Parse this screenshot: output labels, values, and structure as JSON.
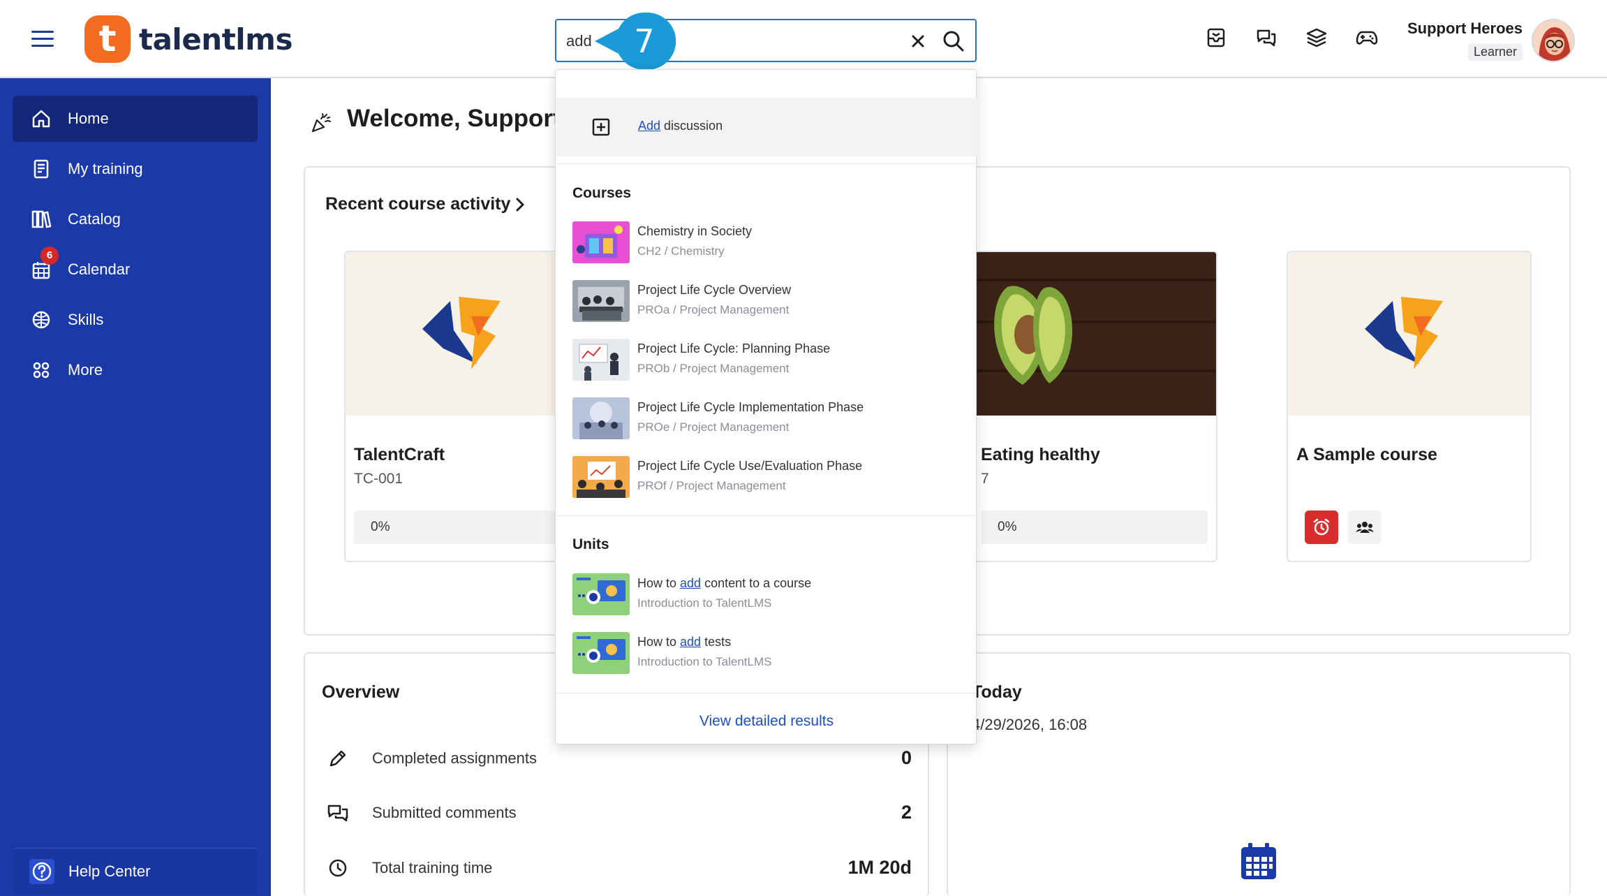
{
  "header": {
    "brand": "talentlms",
    "brand_initial": "t",
    "search": {
      "value": "add",
      "placeholder": ""
    },
    "step_callout": "7",
    "icons": [
      "inbox-icon",
      "discussions-icon",
      "layers-icon",
      "gamepad-icon"
    ],
    "user": {
      "name": "Support Heroes",
      "role": "Learner"
    }
  },
  "sidebar": {
    "items": [
      {
        "label": "Home",
        "icon": "home-icon",
        "active": true
      },
      {
        "label": "My training",
        "icon": "book-icon"
      },
      {
        "label": "Catalog",
        "icon": "catalog-icon"
      },
      {
        "label": "Calendar",
        "icon": "calendar-icon",
        "badge": "6"
      },
      {
        "label": "Skills",
        "icon": "skills-icon"
      },
      {
        "label": "More",
        "icon": "grid-icon"
      }
    ],
    "help": "Help Center"
  },
  "main": {
    "welcome": "Welcome, Support Heroes",
    "recent": {
      "title": "Recent course activity",
      "cards": [
        {
          "title": "TalentCraft",
          "code": "TC-001",
          "progress": "0%"
        },
        {
          "title": "Eating healthy",
          "code": "7",
          "progress": "0%"
        },
        {
          "title": "A Sample course",
          "code": ""
        }
      ]
    },
    "overview": {
      "title": "Overview",
      "rows": [
        {
          "label": "Completed assignments",
          "value": "0",
          "icon": "pencil-icon"
        },
        {
          "label": "Submitted comments",
          "value": "2",
          "icon": "comments-icon"
        },
        {
          "label": "Total training time",
          "value": "1M 20d",
          "icon": "clock-icon"
        }
      ]
    },
    "today": {
      "title": "Today",
      "date": "4/29/2026, 16:08"
    }
  },
  "dropdown": {
    "action": {
      "highlight": "Add",
      "rest": " discussion"
    },
    "courses_heading": "Courses",
    "courses": [
      {
        "title": "Chemistry in Society",
        "sub": "CH2 / Chemistry"
      },
      {
        "title": "Project Life Cycle Overview",
        "sub": "PROa / Project Management"
      },
      {
        "title": "Project Life Cycle: Planning Phase",
        "sub": "PROb / Project Management"
      },
      {
        "title": "Project Life Cycle Implementation Phase",
        "sub": "PROe / Project Management"
      },
      {
        "title": "Project Life Cycle Use/Evaluation Phase",
        "sub": "PROf / Project Management"
      }
    ],
    "units_heading": "Units",
    "units": [
      {
        "pre": "How to ",
        "hl": "add",
        "post": " content to a course",
        "sub": "Introduction to TalentLMS"
      },
      {
        "pre": "How to ",
        "hl": "add",
        "post": " tests",
        "sub": "Introduction to TalentLMS"
      }
    ],
    "footer": "View detailed results"
  },
  "colors": {
    "sidebar": "#1b3aa8",
    "sidebar_active": "#13267a",
    "brand": "#f36a21",
    "link": "#1e4fbf",
    "callout": "#1a9ad6"
  }
}
